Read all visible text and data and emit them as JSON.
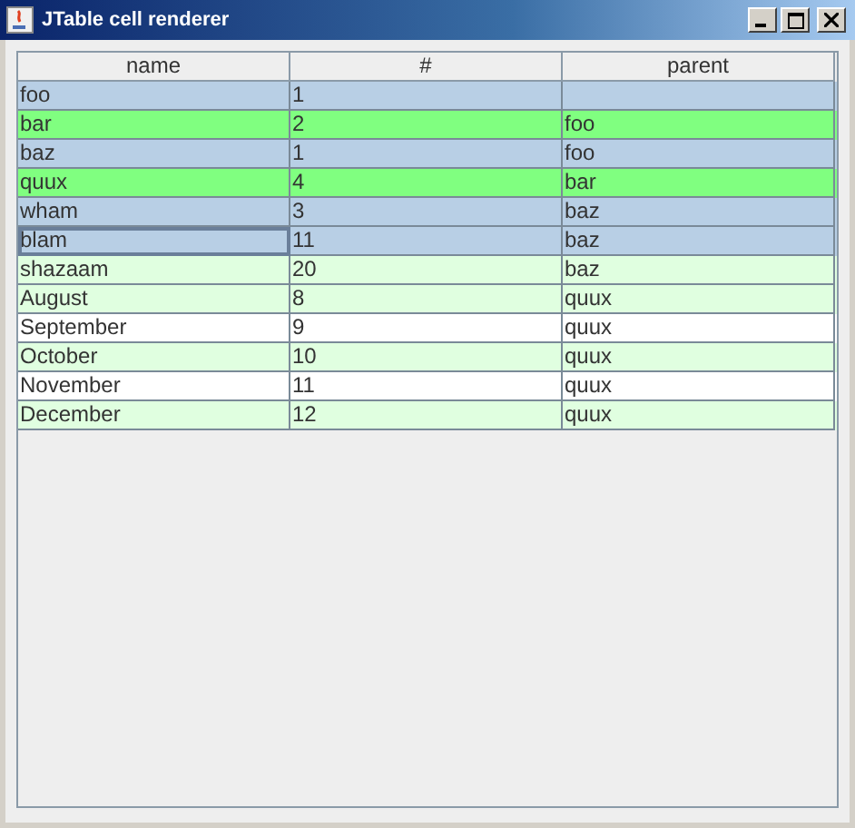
{
  "window": {
    "title": "JTable cell renderer"
  },
  "table": {
    "columns": [
      "name",
      "#",
      "parent"
    ],
    "rows": [
      {
        "cells": [
          "foo",
          "1",
          ""
        ],
        "color": "#b8cfe5",
        "focused": false
      },
      {
        "cells": [
          "bar",
          "2",
          "foo"
        ],
        "color": "#80ff80",
        "focused": false
      },
      {
        "cells": [
          "baz",
          "1",
          "foo"
        ],
        "color": "#b8cfe5",
        "focused": false
      },
      {
        "cells": [
          "quux",
          "4",
          "bar"
        ],
        "color": "#80ff80",
        "focused": false
      },
      {
        "cells": [
          "wham",
          "3",
          "baz"
        ],
        "color": "#b8cfe5",
        "focused": false
      },
      {
        "cells": [
          "blam",
          "11",
          "baz"
        ],
        "color": "#b8cfe5",
        "focused": true
      },
      {
        "cells": [
          "shazaam",
          "20",
          "baz"
        ],
        "color": "#e0ffe0",
        "focused": false
      },
      {
        "cells": [
          "August",
          "8",
          "quux"
        ],
        "color": "#e0ffe0",
        "focused": false
      },
      {
        "cells": [
          "September",
          "9",
          "quux"
        ],
        "color": "#ffffff",
        "focused": false
      },
      {
        "cells": [
          "October",
          "10",
          "quux"
        ],
        "color": "#e0ffe0",
        "focused": false
      },
      {
        "cells": [
          "November",
          "11",
          "quux"
        ],
        "color": "#ffffff",
        "focused": false
      },
      {
        "cells": [
          "December",
          "12",
          "quux"
        ],
        "color": "#e0ffe0",
        "focused": false
      }
    ]
  }
}
